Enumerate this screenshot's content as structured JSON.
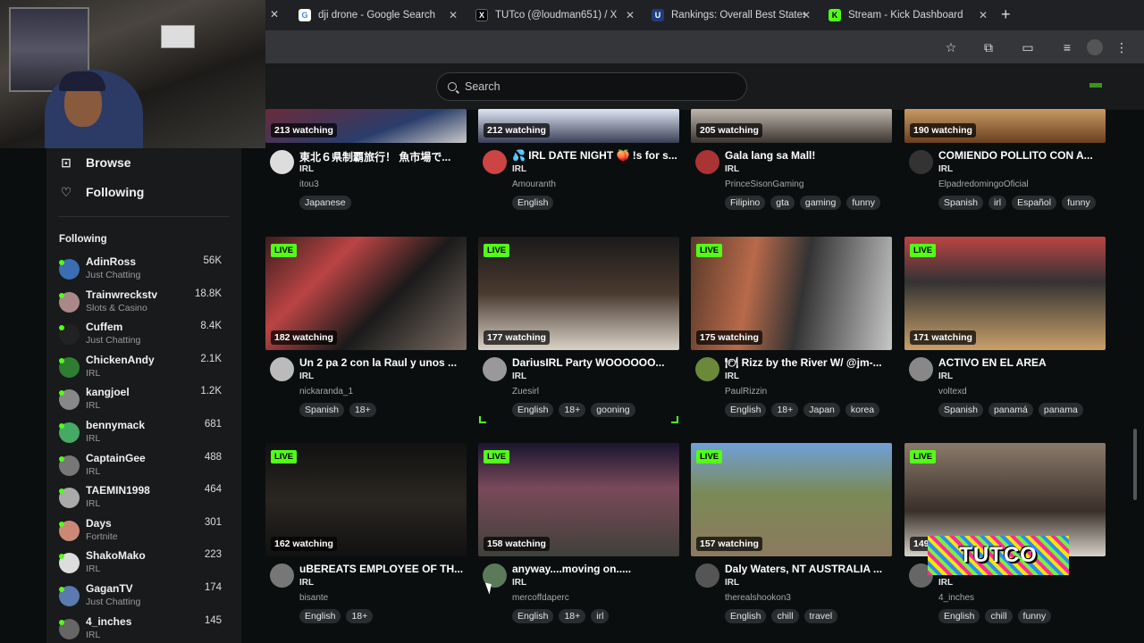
{
  "tabs": [
    {
      "title": "dji drone - Google Search",
      "favicon": "google-icon",
      "color": "#4285f4"
    },
    {
      "title": "TUTco (@loudman651) / X",
      "favicon": "x-icon",
      "color": "#000000"
    },
    {
      "title": "Rankings: Overall Best States",
      "favicon": "usnews-icon",
      "color": "#c8102e"
    },
    {
      "title": "Stream - Kick Dashboard",
      "favicon": "kick-icon",
      "color": "#53fc18"
    }
  ],
  "search": {
    "placeholder": "Search"
  },
  "nav": {
    "browse": "Browse",
    "following": "Following"
  },
  "following_header": "Following",
  "accent_color": "#53fc18",
  "followed": [
    {
      "name": "AdinRoss",
      "category": "Just Chatting",
      "viewers": "56K",
      "color": "#3b6db3"
    },
    {
      "name": "Trainwreckstv",
      "category": "Slots & Casino",
      "viewers": "18.8K",
      "color": "#a88"
    },
    {
      "name": "Cuffem",
      "category": "Just Chatting",
      "viewers": "8.4K",
      "color": "#222"
    },
    {
      "name": "ChickenAndy",
      "category": "IRL",
      "viewers": "2.1K",
      "color": "#2f7d32"
    },
    {
      "name": "kangjoel",
      "category": "IRL",
      "viewers": "1.2K",
      "color": "#888"
    },
    {
      "name": "bennymack",
      "category": "IRL",
      "viewers": "681",
      "color": "#4a6"
    },
    {
      "name": "CaptainGee",
      "category": "IRL",
      "viewers": "488",
      "color": "#777"
    },
    {
      "name": "TAEMIN1998",
      "category": "IRL",
      "viewers": "464",
      "color": "#aaa"
    },
    {
      "name": "Days",
      "category": "Fortnite",
      "viewers": "301",
      "color": "#c87"
    },
    {
      "name": "ShakoMako",
      "category": "IRL",
      "viewers": "223",
      "color": "#ddd"
    },
    {
      "name": "GaganTV",
      "category": "Just Chatting",
      "viewers": "174",
      "color": "#5a7ab0"
    },
    {
      "name": "4_inches",
      "category": "IRL",
      "viewers": "145",
      "color": "#666"
    }
  ],
  "streams": [
    {
      "watching": "213 watching",
      "live": "",
      "title": "東北６県制覇旅行！ 魚市場で...",
      "category": "IRL",
      "user": "itou3",
      "tags": [
        "Japanese"
      ],
      "thumb": "linear-gradient(160deg,#6a2b3a,#2a3d6b 60%,#c9c9c9)",
      "avatar": "#ddd"
    },
    {
      "watching": "212 watching",
      "live": "",
      "title": "💦 IRL DATE NIGHT 🍑 !s for s...",
      "category": "IRL",
      "user": "Amouranth",
      "tags": [
        "English"
      ],
      "thumb": "linear-gradient(180deg,#dfe6f2,#3a3f57)",
      "avatar": "#c44"
    },
    {
      "watching": "205 watching",
      "live": "",
      "title": "Gala lang sa Mall!",
      "category": "IRL",
      "user": "PrinceSisonGaming",
      "tags": [
        "Filipino",
        "gta",
        "gaming",
        "funny"
      ],
      "thumb": "linear-gradient(180deg,#bfb7ad,#3b3530)",
      "avatar": "#a33"
    },
    {
      "watching": "190 watching",
      "live": "",
      "title": "COMIENDO POLLITO CON A...",
      "category": "IRL",
      "user": "ElpadredomingoOficial",
      "tags": [
        "Spanish",
        "irl",
        "Español",
        "funny"
      ],
      "thumb": "linear-gradient(180deg,#c79a63,#6b3f1f)",
      "avatar": "#333"
    },
    {
      "watching": "182 watching",
      "live": "LIVE",
      "title": "Un 2 pa 2 con la Raul y unos ...",
      "category": "IRL",
      "user": "nickaranda_1",
      "tags": [
        "Spanish",
        "18+"
      ],
      "thumb": "linear-gradient(135deg,#3a1e1e,#b44 30%,#1a1a1a 60%,#7a6c62)",
      "avatar": "#bbb"
    },
    {
      "watching": "177 watching",
      "live": "LIVE",
      "title": "DariusIRL Party WOOOOOO...",
      "category": "IRL",
      "user": "Zuesirl",
      "tags": [
        "English",
        "18+",
        "gooning"
      ],
      "thumb": "linear-gradient(180deg,#1a1a1a,#4a3a30 50%,#d9d2c7)",
      "avatar": "#999"
    },
    {
      "watching": "175 watching",
      "live": "LIVE",
      "title": "🍽 Rizz by the River W/ @jm-...",
      "category": "IRL",
      "user": "PaulRizzin",
      "tags": [
        "English",
        "18+",
        "Japan",
        "korea"
      ],
      "thumb": "linear-gradient(100deg,#5a3a2a,#b86a4a 30%,#333 55%,#c7c7c7)",
      "avatar": "#6a8a3a"
    },
    {
      "watching": "171 watching",
      "live": "LIVE",
      "title": "ACTIVO EN EL AREA",
      "category": "IRL",
      "user": "voltexd",
      "tags": [
        "Spanish",
        "panamá",
        "panama"
      ],
      "thumb": "linear-gradient(180deg,#b44,#333 40%,#c9a06a)",
      "avatar": "#888"
    },
    {
      "watching": "162 watching",
      "live": "LIVE",
      "title": "uBEREATS EMPLOYEE OF TH...",
      "category": "IRL",
      "user": "bisante",
      "tags": [
        "English",
        "18+"
      ],
      "thumb": "linear-gradient(180deg,#111,#2a2622 50%,#111)",
      "avatar": "#777"
    },
    {
      "watching": "158 watching",
      "live": "LIVE",
      "title": "anyway....moving on.....",
      "category": "IRL",
      "user": "mercoffdaperc",
      "tags": [
        "English",
        "18+",
        "irl"
      ],
      "thumb": "linear-gradient(180deg,#1a1530,#7a4a5a 40%,#40403a)",
      "avatar": "#5a7a5a"
    },
    {
      "watching": "157 watching",
      "live": "LIVE",
      "title": "Daly Waters, NT AUSTRALIA ...",
      "category": "IRL",
      "user": "therealshookon3",
      "tags": [
        "English",
        "chill",
        "travel"
      ],
      "thumb": "linear-gradient(180deg,#6fa0d8,#7a8a55 45%,#8c7a5f)",
      "avatar": "#555"
    },
    {
      "watching": "149 watching",
      "live": "LIVE",
      "title": "...N...",
      "category": "IRL",
      "user": "4_inches",
      "tags": [
        "English",
        "chill",
        "funny"
      ],
      "thumb": "linear-gradient(180deg,#8a7a6a,#3a302a 60%,#d7d2c9)",
      "avatar": "#666"
    }
  ],
  "overlay_logo": "TUTCO"
}
